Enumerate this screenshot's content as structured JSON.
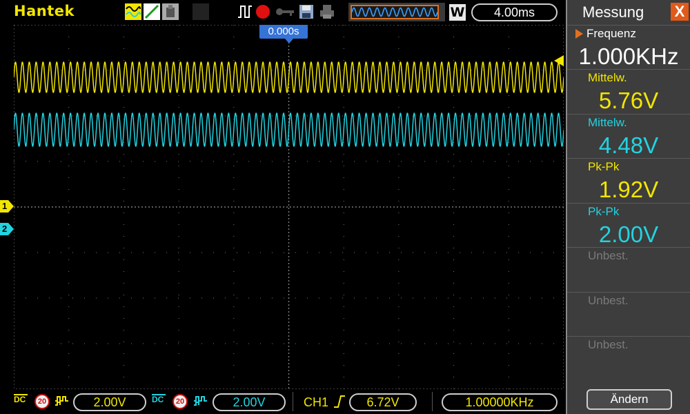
{
  "app": {
    "brand": "Hantek"
  },
  "toolbar": {
    "icons": [
      "waveform-mode-icon",
      "line-mode-icon",
      "persist-icon",
      "trigger-mode-icon",
      "record-icon",
      "key-icon",
      "save-icon",
      "print-icon"
    ],
    "wave_badge": "W",
    "timebase": "4.00ms"
  },
  "screen": {
    "trigger_position": "0.000s",
    "ch1_marker": "1",
    "ch2_marker": "2",
    "colors": {
      "ch1": "#f2e600",
      "ch2": "#22d3e0",
      "grid": "#7a7a7a"
    },
    "ch1_signal": {
      "frequency_hz": 1000,
      "cycles_visible": 80
    },
    "ch2_signal": {
      "cycles_visible": 80
    }
  },
  "bottombar": {
    "ch1": {
      "coupling": "DC",
      "bw_limit": "20",
      "volts_div": "2.00V"
    },
    "ch2": {
      "coupling": "DC",
      "bw_limit": "20",
      "volts_div": "2.00V"
    },
    "trigger_source": "CH1",
    "trigger_level": "6.72V",
    "frequency_counter": "1.00000KHz"
  },
  "panel": {
    "title": "Messung",
    "close_label": "X",
    "measurements": [
      {
        "label": "Frequenz",
        "value": "1.000KHz",
        "label_color": "#ffffff",
        "value_color": "#ffffff"
      },
      {
        "label": "Mittelw.",
        "value": "5.76V",
        "label_color": "#f2e600",
        "value_color": "#f2e600"
      },
      {
        "label": "Mittelw.",
        "value": "4.48V",
        "label_color": "#22d3e0",
        "value_color": "#22d3e0"
      },
      {
        "label": "Pk-Pk",
        "value": "1.92V",
        "label_color": "#f2e600",
        "value_color": "#f2e600"
      },
      {
        "label": "Pk-Pk",
        "value": "2.00V",
        "label_color": "#22d3e0",
        "value_color": "#22d3e0"
      },
      {
        "label": "Unbest.",
        "value": "",
        "label_color": "#7a7a7a",
        "value_color": "#7a7a7a"
      },
      {
        "label": "Unbest.",
        "value": "",
        "label_color": "#7a7a7a",
        "value_color": "#7a7a7a"
      },
      {
        "label": "Unbest.",
        "value": "",
        "label_color": "#7a7a7a",
        "value_color": "#7a7a7a"
      }
    ],
    "change_button": "Ändern"
  }
}
